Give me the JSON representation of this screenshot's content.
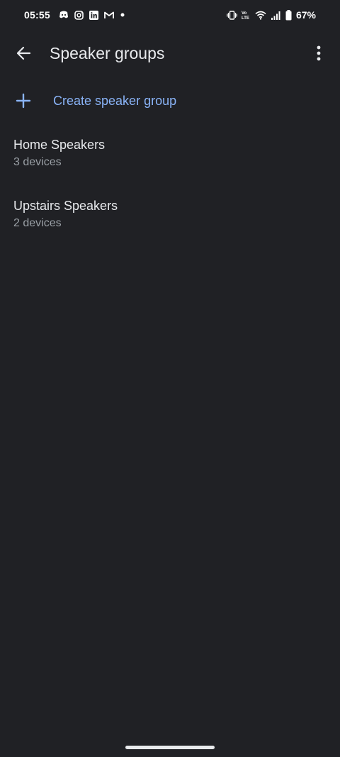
{
  "status_bar": {
    "time": "05:55",
    "battery": "67%",
    "left_icons": [
      "discord-icon",
      "instagram-icon",
      "linkedin-icon",
      "gmail-icon",
      "dot-icon"
    ],
    "right_icons": [
      "vibrate-icon",
      "volte-icon",
      "wifi-icon",
      "signal-icon",
      "battery-icon"
    ]
  },
  "app_bar": {
    "title": "Speaker groups"
  },
  "create": {
    "label": "Create speaker group"
  },
  "groups": [
    {
      "name": "Home Speakers",
      "count": "3 devices"
    },
    {
      "name": "Upstairs Speakers",
      "count": "2 devices"
    }
  ],
  "colors": {
    "background": "#202125",
    "accent": "#8ab4f8",
    "primary_text": "#e8eaed",
    "secondary_text": "#9aa0a6"
  }
}
